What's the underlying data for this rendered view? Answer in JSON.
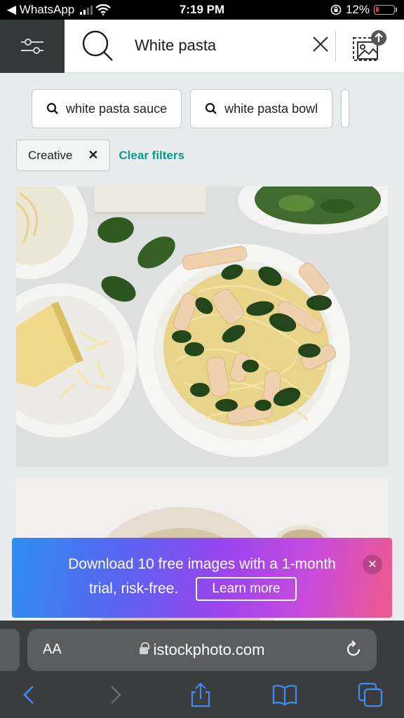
{
  "status_bar": {
    "back_app": "◀ WhatsApp",
    "time": "7:19 PM",
    "battery": "12%"
  },
  "header": {
    "search_value": "White pasta"
  },
  "suggestions": [
    {
      "label": "white pasta sauce"
    },
    {
      "label": "white pasta bowl"
    }
  ],
  "filters": {
    "active_tag": "Creative",
    "remove_symbol": "✕",
    "clear_label": "Clear filters"
  },
  "promo": {
    "line1": "Download 10 free images with a 1-month",
    "line2": "trial, risk-free.",
    "button": "Learn more",
    "close": "✕"
  },
  "browser": {
    "text_size_label": "AA",
    "domain": "istockphoto.com"
  },
  "colors": {
    "accent_link": "#0b9a8a",
    "filter_button_bg": "#323737",
    "browser_icon": "#3a8ef5"
  }
}
